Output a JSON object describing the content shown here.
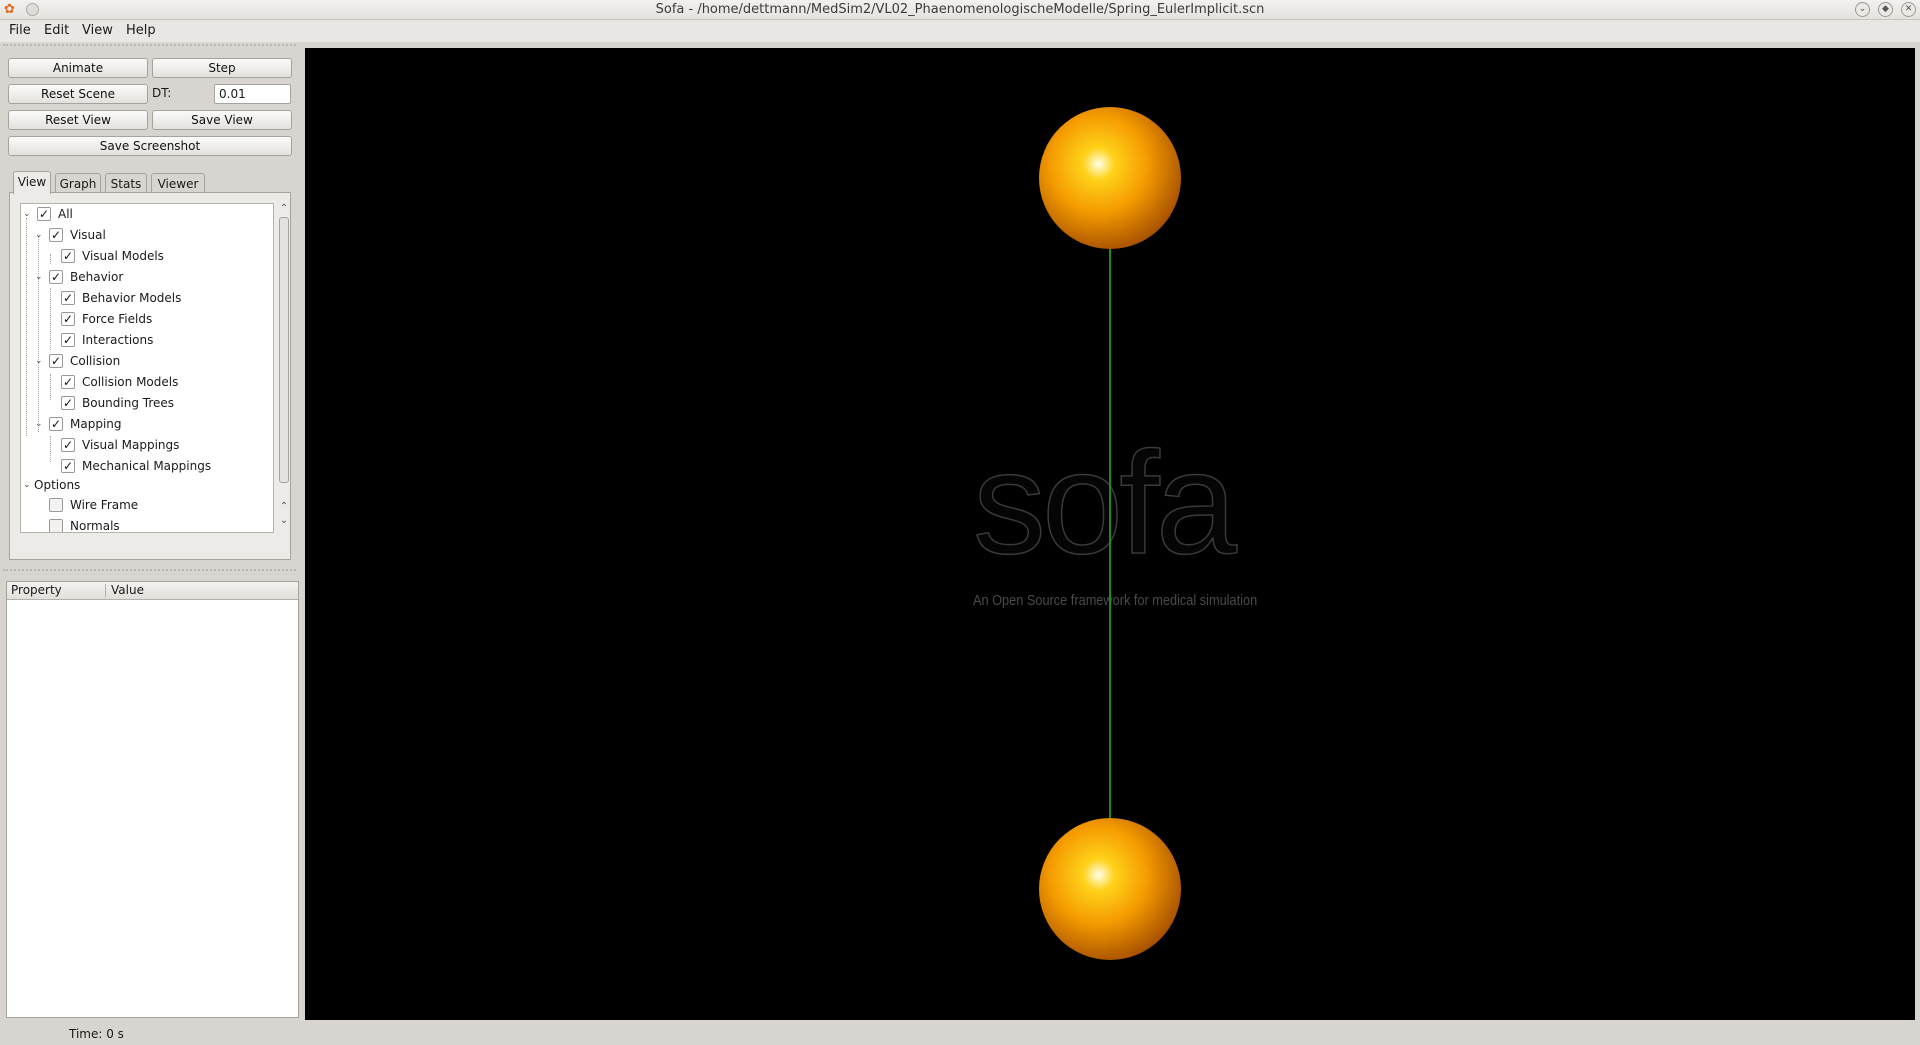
{
  "window": {
    "title": "Sofa - /home/dettmann/MedSim2/VL02_PhaenomenologischeModelle/Spring_EulerImplicit.scn"
  },
  "menu": [
    "File",
    "Edit",
    "View",
    "Help"
  ],
  "controls": {
    "animate": "Animate",
    "step": "Step",
    "reset_scene": "Reset Scene",
    "dt_label": "DT:",
    "dt_value": "0.01",
    "reset_view": "Reset View",
    "save_view": "Save View",
    "save_screenshot": "Save Screenshot"
  },
  "tabs": [
    "View",
    "Graph",
    "Stats",
    "Viewer"
  ],
  "tree": {
    "all": "All",
    "visual": "Visual",
    "visual_models": "Visual Models",
    "behavior": "Behavior",
    "behavior_models": "Behavior Models",
    "force_fields": "Force Fields",
    "interactions": "Interactions",
    "collision": "Collision",
    "collision_models": "Collision Models",
    "bounding_trees": "Bounding Trees",
    "mapping": "Mapping",
    "visual_mappings": "Visual Mappings",
    "mechanical_mappings": "Mechanical Mappings",
    "options": "Options",
    "wire_frame": "Wire Frame",
    "normals": "Normals"
  },
  "property_table": {
    "col_property": "Property",
    "col_value": "Value"
  },
  "viewport": {
    "logo": "sofa",
    "tagline": "An Open Source framework for medical simulation",
    "sphere_color": "#f59b00",
    "spring_color": "#1d8a1d",
    "background": "#000000"
  },
  "status": {
    "time": "Time: 0 s"
  }
}
